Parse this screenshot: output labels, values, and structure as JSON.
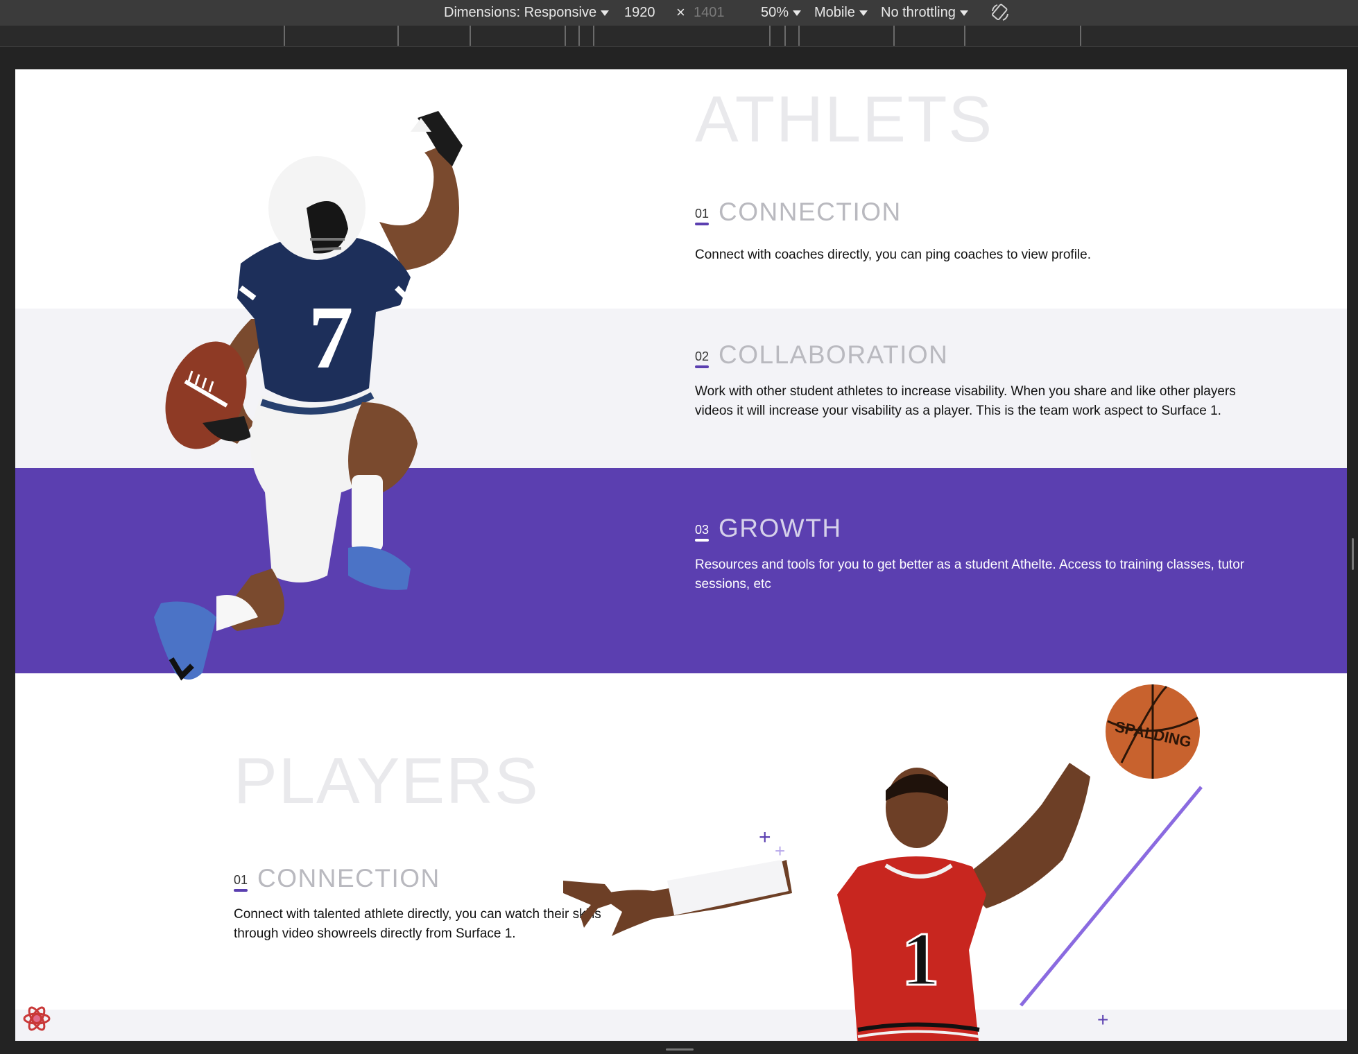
{
  "toolbar": {
    "dimensions_label": "Dimensions: Responsive",
    "width": "1920",
    "times": "×",
    "height": "1401",
    "zoom": "50%",
    "device": "Mobile",
    "throttling": "No throttling"
  },
  "athletes": {
    "title": "ATHLETS",
    "features": [
      {
        "num": "01",
        "title": "CONNECTION",
        "desc": "Connect with coaches directly, you can ping coaches to view profile."
      },
      {
        "num": "02",
        "title": "COLLABORATION",
        "desc": "Work with other student athletes to increase visability. When you share and like other players videos it will increase your visability as a player. This is the team work aspect to Surface 1."
      },
      {
        "num": "03",
        "title": "GROWTH",
        "desc": "Resources and tools for you to get better as a student Athelte. Access to training classes, tutor sessions, etc"
      }
    ]
  },
  "players": {
    "title": "PLAYERS",
    "features": [
      {
        "num": "01",
        "title": "CONNECTION",
        "desc": "Connect with talented athlete directly, you can watch their skills through video showreels directly from Surface 1."
      }
    ]
  },
  "football_jersey_number": "7",
  "basketball_jersey_number": "1",
  "basketball_brand": "SPALDING",
  "colors": {
    "accent": "#5b3fb0",
    "light_band": "#f3f3f7",
    "title_gray": "#e9e9ec"
  }
}
